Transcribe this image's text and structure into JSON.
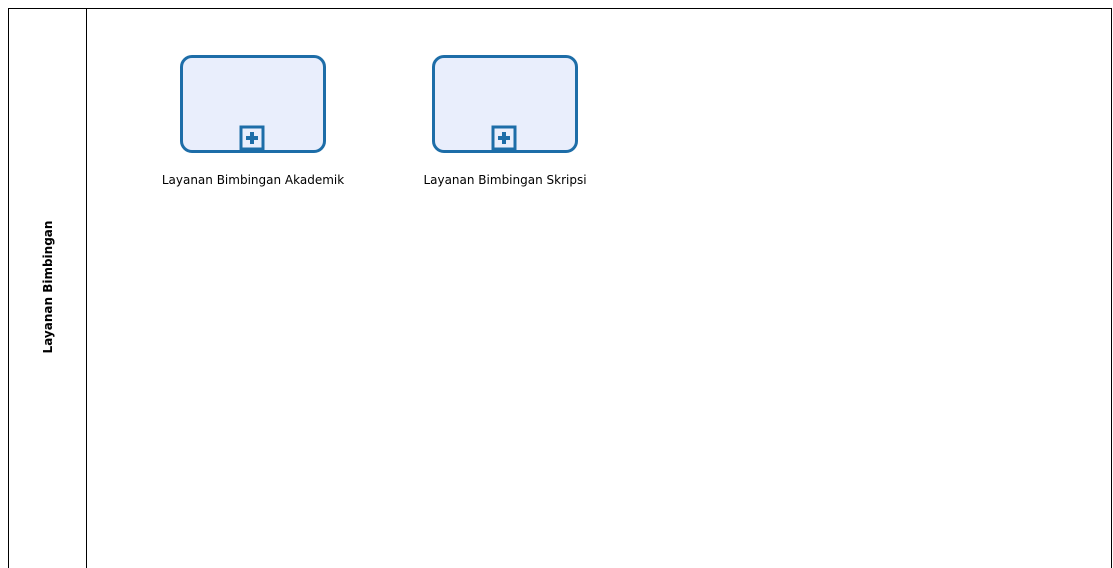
{
  "lane": {
    "title": "Layanan Bimbingan"
  },
  "subprocesses": [
    {
      "label": "Layanan Bimbingan Akademik"
    },
    {
      "label": "Layanan Bimbingan Skripsi"
    }
  ],
  "colors": {
    "task_border": "#1d6da8",
    "task_fill": "#e9eefc",
    "lane_border": "#000000"
  },
  "icons": {
    "collapsed_marker": "plus-square-icon"
  }
}
